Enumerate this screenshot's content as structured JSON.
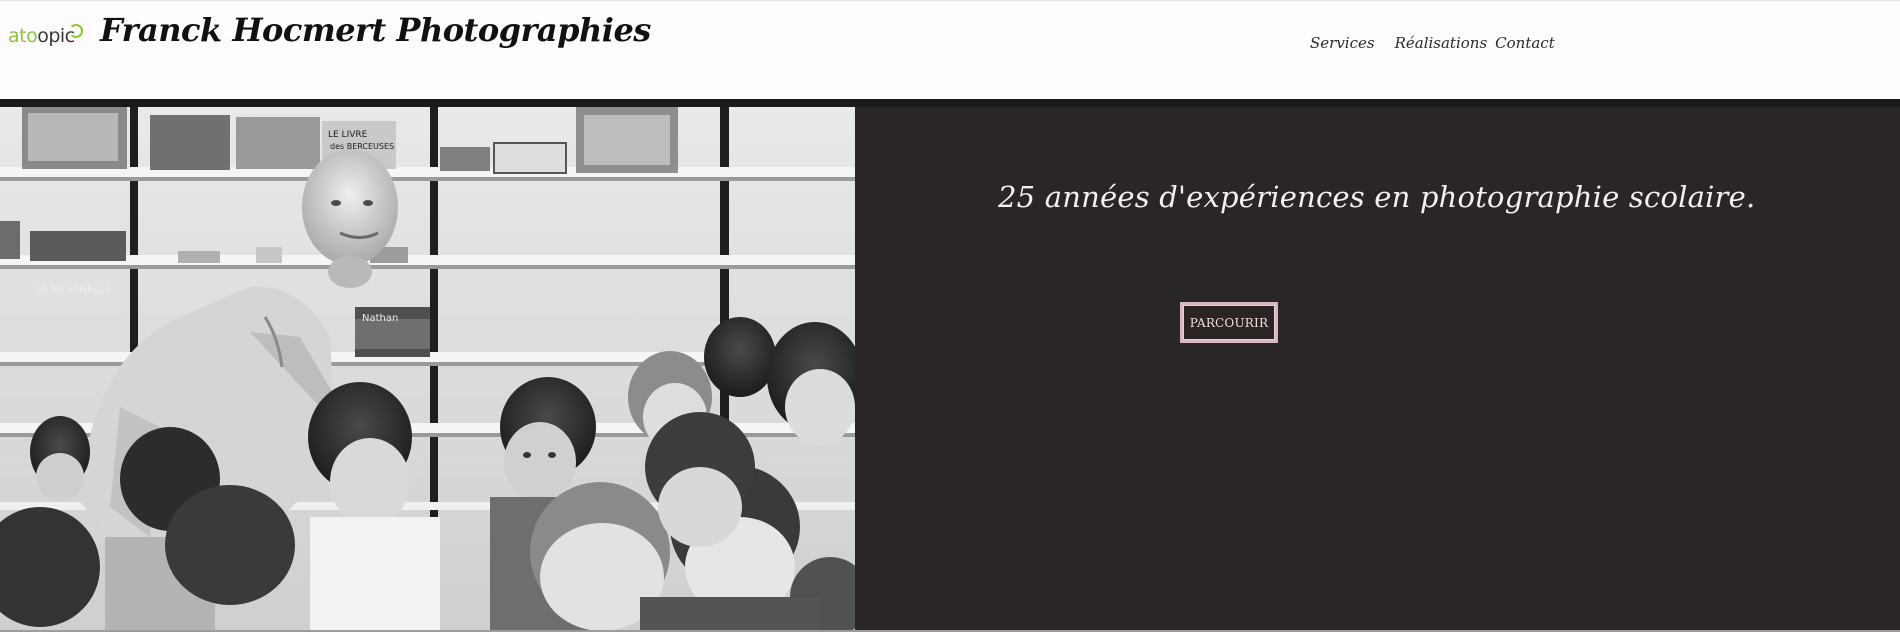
{
  "header": {
    "logo_part1": "ato",
    "logo_part2": "opic",
    "site_title": "Franck Hocmert Photographies"
  },
  "nav": {
    "items": [
      {
        "label": "Services"
      },
      {
        "label": "Réalisations"
      },
      {
        "label": "Contact"
      }
    ]
  },
  "hero": {
    "tagline": "25 années d'expériences en photographie scolaire.",
    "cta_label": "PARCOURIR",
    "photo_book_labels": [
      "LE LIVRE des BERCEUSES",
      "Nathan",
      "50 RIS ESPIEGLE"
    ],
    "photo_icon": "classroom-photo"
  },
  "colors": {
    "logo_green": "#8cc43c",
    "hero_background": "#292625",
    "cta_border": "#d8b8c2"
  }
}
